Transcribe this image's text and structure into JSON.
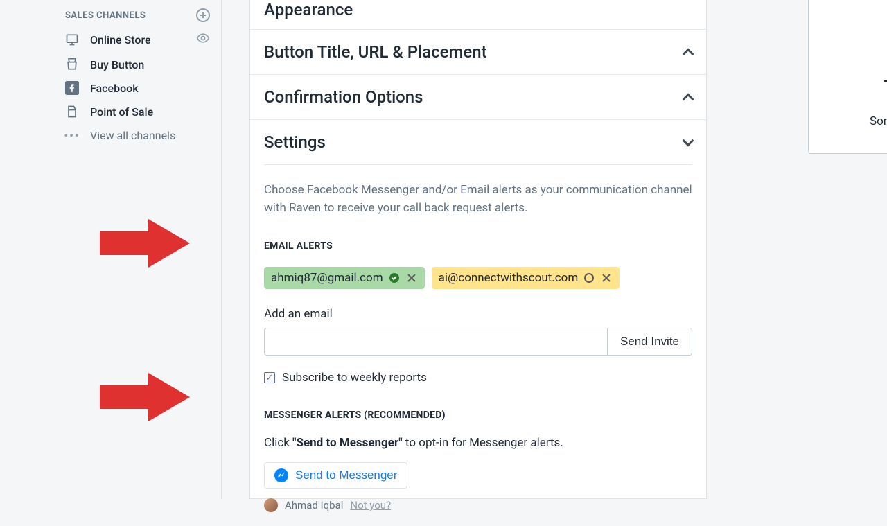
{
  "sidebar": {
    "section_title": "SALES CHANNELS",
    "items": [
      {
        "label": "Online Store"
      },
      {
        "label": "Buy Button"
      },
      {
        "label": "Facebook"
      },
      {
        "label": "Point of Sale"
      },
      {
        "label": "View all channels"
      }
    ]
  },
  "sections": {
    "appearance": "Appearance",
    "button_title": "Button Title, URL & Placement",
    "confirmation": "Confirmation Options",
    "settings": "Settings"
  },
  "settings_panel": {
    "description": "Choose Facebook Messenger and/or Email alerts as your communication channel with Raven to receive your call back request alerts.",
    "email_heading": "EMAIL ALERTS",
    "emails": [
      {
        "address": "ahmiq87@gmail.com",
        "status": "verified"
      },
      {
        "address": "ai@connectwithscout.com",
        "status": "pending"
      }
    ],
    "add_email_label": "Add an email",
    "send_invite": "Send Invite",
    "subscribe_label": "Subscribe to weekly reports",
    "subscribe_checked": true,
    "messenger_heading": "MESSENGER ALERTS (RECOMMENDED)",
    "messenger_instruction_prefix": "Click ",
    "messenger_instruction_bold": "\"Send to Messenger\"",
    "messenger_instruction_suffix": " to opt-in for Messenger alerts.",
    "messenger_button": "Send to Messenger",
    "user_name": "Ahmad Iqbal",
    "not_you": "Not you?"
  },
  "right_panel": {
    "big_fragment": "T",
    "small_fragment": "Som"
  }
}
